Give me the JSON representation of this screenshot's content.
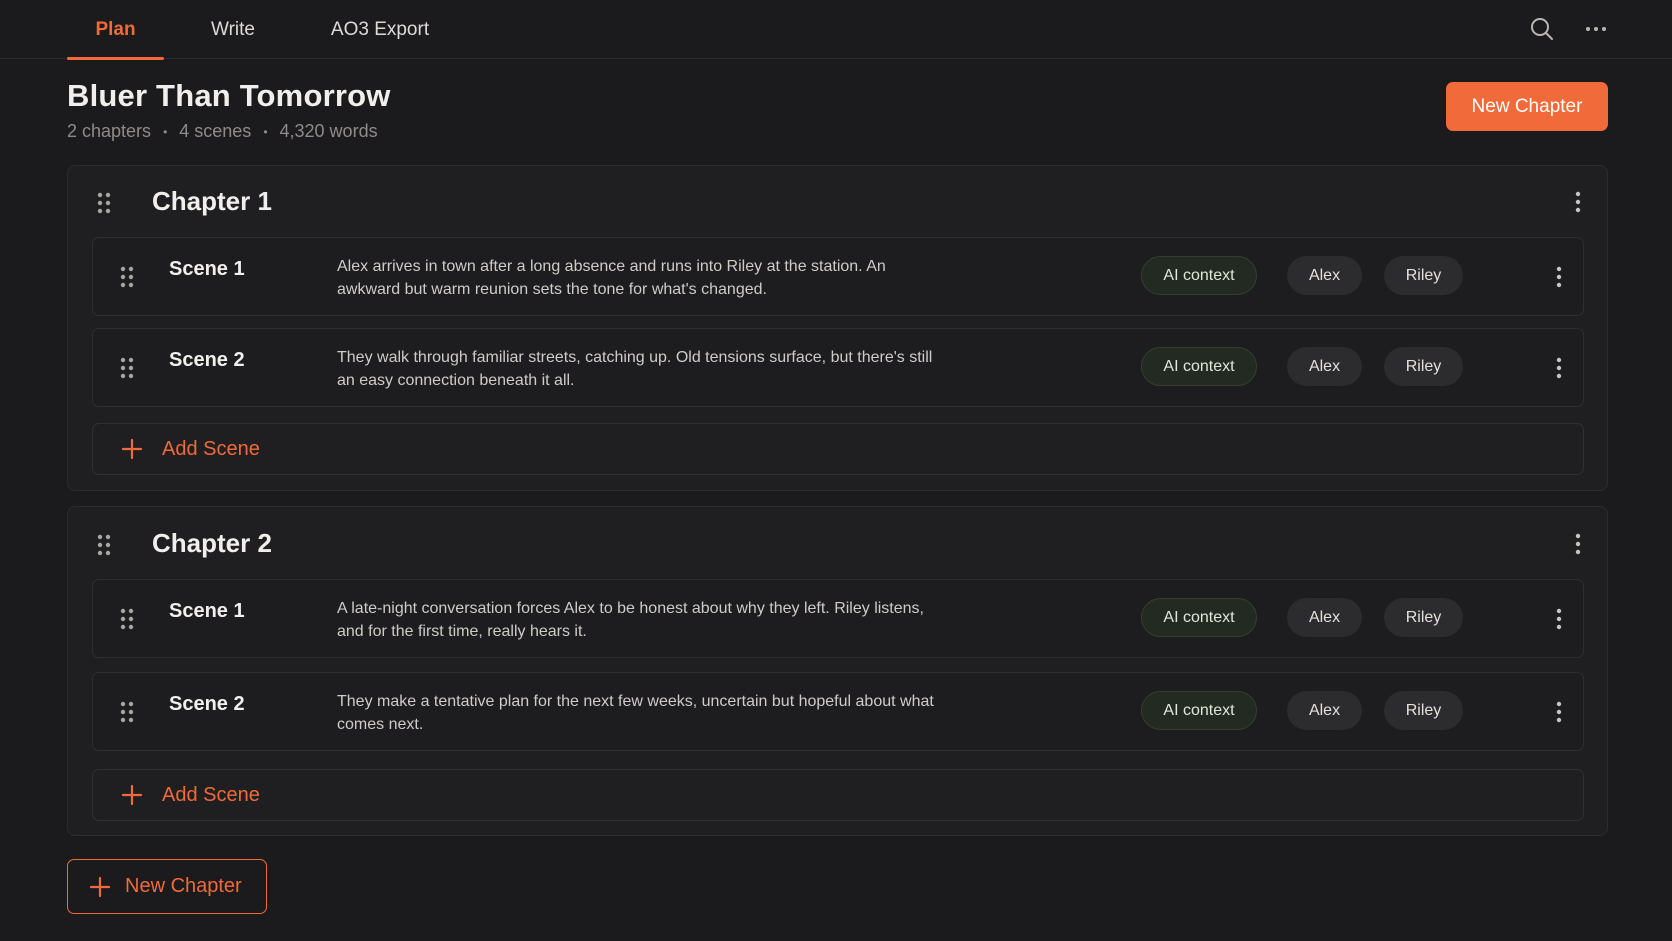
{
  "nav": {
    "tabs": [
      {
        "label": "Plan",
        "active": true
      },
      {
        "label": "Write",
        "active": false
      },
      {
        "label": "AO3 Export",
        "active": false
      }
    ],
    "icons": [
      "search-icon",
      "more-horizontal-icon"
    ]
  },
  "project": {
    "title": "Bluer Than Tomorrow",
    "chapters_count": "2 chapters",
    "scenes_count": "4 scenes",
    "words_count": "4,320 words",
    "separator": "•"
  },
  "actions": {
    "new_chapter_label": "New Chapter",
    "add_scene_label": "Add Scene"
  },
  "colors": {
    "accent": "#f06a3a",
    "background": "#1b1b1d",
    "card": "#1f1f21",
    "ai_chip": "#222a22"
  },
  "chapters": [
    {
      "title": "Chapter 1",
      "scenes": [
        {
          "title": "Scene 1",
          "description": "Alex arrives in town after a long absence and runs into Riley at the station. An awkward but warm reunion sets the tone for what's changed.",
          "tags": [
            "AI context",
            "Alex",
            "Riley"
          ]
        },
        {
          "title": "Scene 2",
          "description": "They walk through familiar streets, catching up. Old tensions surface, but there's still an easy connection beneath it all.",
          "tags": [
            "AI context",
            "Alex",
            "Riley"
          ]
        }
      ]
    },
    {
      "title": "Chapter 2",
      "scenes": [
        {
          "title": "Scene 1",
          "description": "A late-night conversation forces Alex to be honest about why they left. Riley listens, and for the first time, really hears it.",
          "tags": [
            "AI context",
            "Alex",
            "Riley"
          ]
        },
        {
          "title": "Scene 2",
          "description": "They make a tentative plan for the next few weeks, uncertain but hopeful about what comes next.",
          "tags": [
            "AI context",
            "Alex",
            "Riley"
          ]
        }
      ]
    }
  ]
}
